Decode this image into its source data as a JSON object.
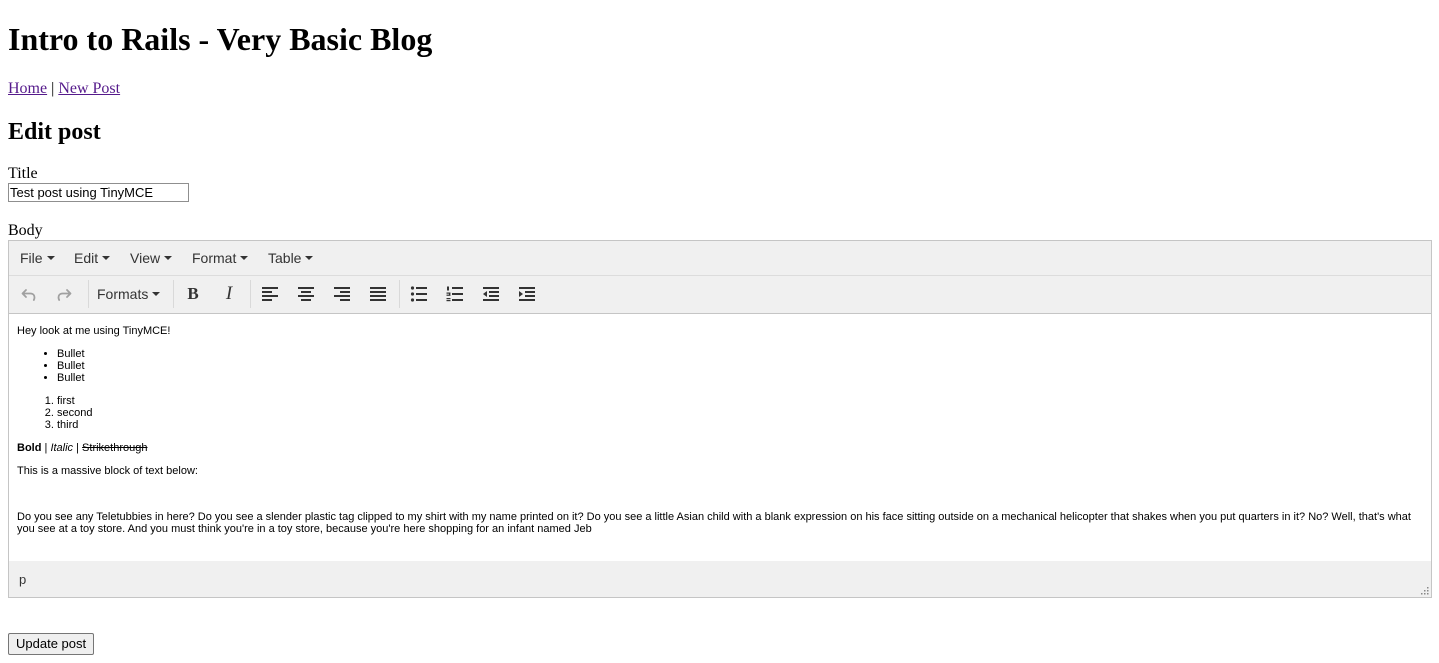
{
  "page": {
    "heading": "Intro to Rails - Very Basic Blog",
    "nav": {
      "home": "Home",
      "separator": "|",
      "new_post": "New Post"
    },
    "form_heading": "Edit post"
  },
  "form": {
    "title_label": "Title",
    "title_value": "Test post using TinyMCE",
    "body_label": "Body",
    "submit_label": "Update post"
  },
  "editor": {
    "menu": [
      "File",
      "Edit",
      "View",
      "Format",
      "Table"
    ],
    "toolbar": {
      "undo": "undo-icon",
      "redo": "redo-icon",
      "formats": "Formats",
      "bold": "B",
      "italic": "I",
      "align": [
        "align-left-icon",
        "align-center-icon",
        "align-right-icon",
        "align-justify-icon"
      ],
      "lists": [
        "bullet-list-icon",
        "numbered-list-icon"
      ],
      "indent": [
        "outdent-icon",
        "indent-icon"
      ]
    },
    "content": {
      "intro": "Hey look at me using TinyMCE!",
      "bullets": [
        "Bullet",
        "Bullet",
        "Bullet"
      ],
      "numbered": [
        "first",
        "second",
        "third"
      ],
      "format_line": {
        "bold": "Bold",
        "sep": "|",
        "italic": "Italic",
        "strike": "Strikethrough"
      },
      "massive_label": "This is a massive block of text below:",
      "massive_text": "Do you see any Teletubbies in here? Do you see a slender plastic tag clipped to my shirt with my name printed on it? Do you see a little Asian child with a blank expression on his face sitting outside on a mechanical helicopter that shakes when you put quarters in it? No? Well, that's what you see at a toy store. And you must think you're in a toy store, because you're here shopping for an infant named Jeb"
    },
    "status_path": "p"
  },
  "colors": {
    "link": "#551a8b",
    "editor_chrome": "#f0f0f0",
    "editor_border": "#c5c5c5",
    "icon": "#333333"
  }
}
